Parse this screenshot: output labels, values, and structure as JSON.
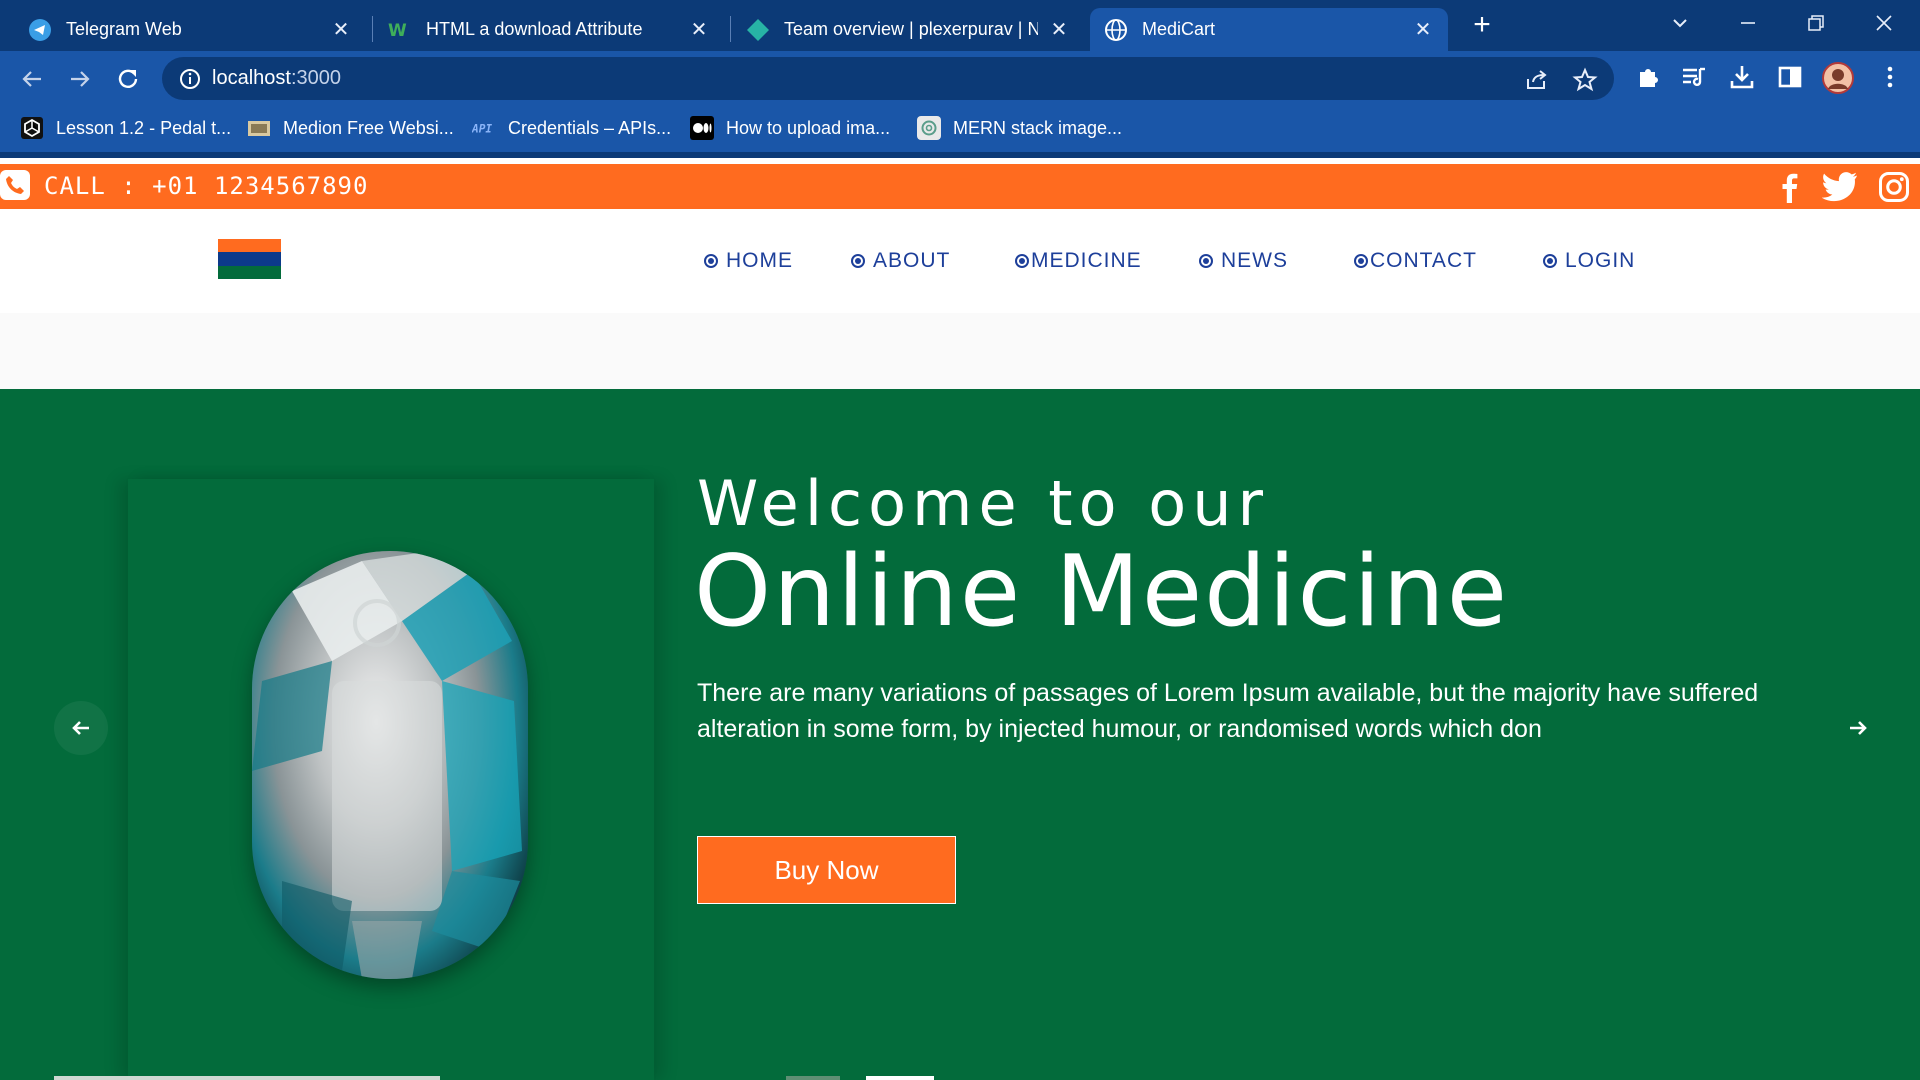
{
  "browser": {
    "tabs": [
      {
        "title": "Telegram Web",
        "icon": "telegram-icon"
      },
      {
        "title": "HTML a download Attribute",
        "icon": "w3schools-icon"
      },
      {
        "title": "Team overview | plexerpurav | Ne",
        "icon": "netlify-icon"
      },
      {
        "title": "MediCart",
        "icon": "globe-icon"
      }
    ],
    "active_tab": 3,
    "url_host": "localhost",
    "url_port": ":3000",
    "bookmarks": [
      {
        "title": "Lesson 1.2 - Pedal t...",
        "icon": "unity-icon"
      },
      {
        "title": "Medion Free Websi...",
        "icon": "image-icon"
      },
      {
        "title": "Credentials – APIs...",
        "icon": "api-icon"
      },
      {
        "title": "How to upload ima...",
        "icon": "medium-icon"
      },
      {
        "title": "MERN stack image...",
        "icon": "chatgpt-icon"
      }
    ]
  },
  "topbar": {
    "call": "CALL : +01 1234567890"
  },
  "nav": {
    "items": [
      "HOME",
      "ABOUT",
      "MEDICINE",
      "NEWS",
      "CONTACT",
      "LOGIN"
    ]
  },
  "hero": {
    "welcome": "Welcome to our",
    "headline": "Online Medicine",
    "description": "There are many variations of passages of Lorem Ipsum available, but the majority have suffered alteration in some form, by injected humour, or randomised words which don",
    "button": "Buy Now"
  },
  "colors": {
    "chrome_dark": "#0c3a77",
    "chrome_light": "#1a56a8",
    "accent_orange": "#ff6b1f",
    "hero_green": "#036b3b",
    "nav_blue": "#1d3f9a"
  }
}
